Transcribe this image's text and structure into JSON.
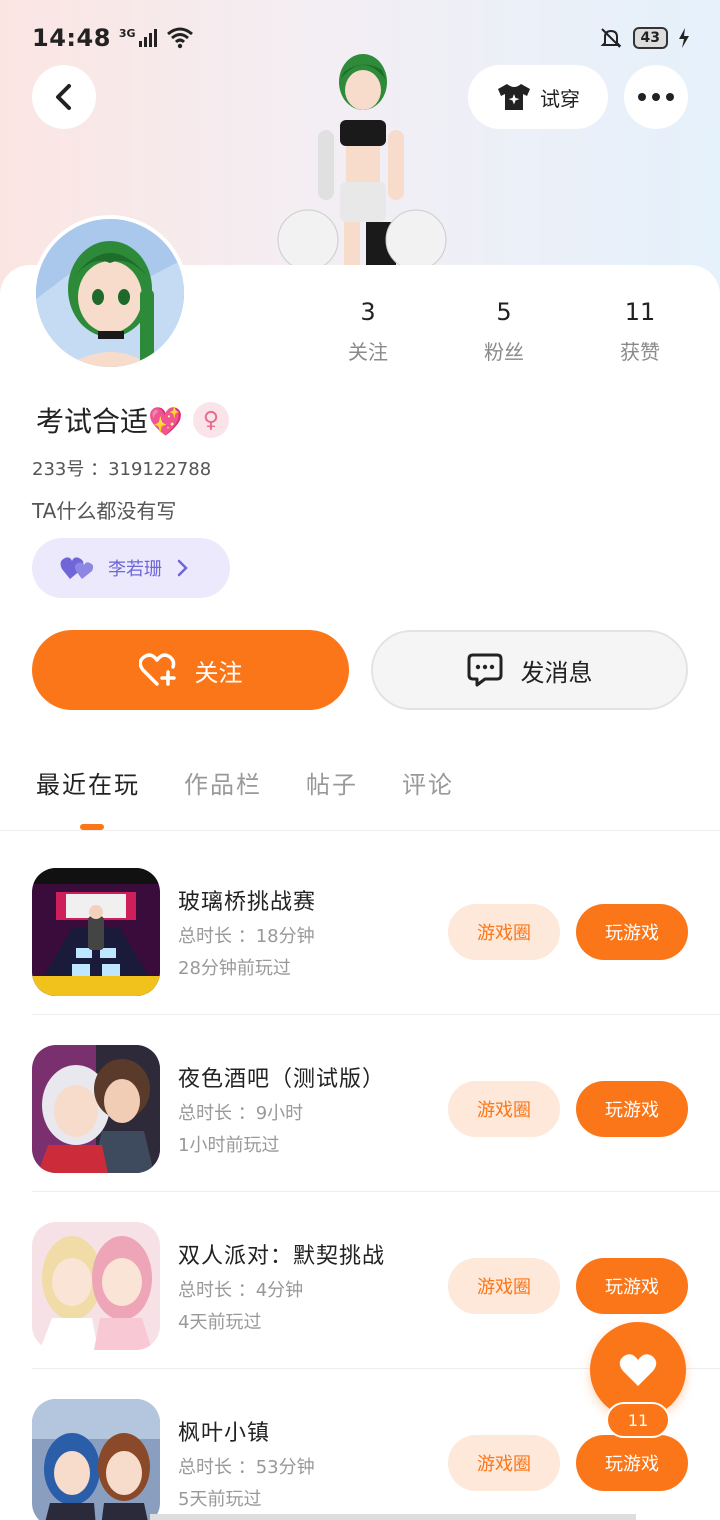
{
  "status_bar": {
    "time": "14:48",
    "network": "3G",
    "battery": "43"
  },
  "header": {
    "tryon_label": "试穿"
  },
  "profile": {
    "username": "考试合适💖",
    "uid": "233号 ：319122788",
    "bio": "TA什么都没有写",
    "cp_name": "李若珊",
    "stats": [
      {
        "value": "3",
        "label": "关注"
      },
      {
        "value": "5",
        "label": "粉丝"
      },
      {
        "value": "11",
        "label": "获赞"
      }
    ]
  },
  "actions": {
    "follow_label": "关注",
    "message_label": "发消息"
  },
  "tabs": [
    {
      "label": "最近在玩"
    },
    {
      "label": "作品栏"
    },
    {
      "label": "帖子"
    },
    {
      "label": "评论"
    }
  ],
  "games": [
    {
      "title": "玻璃桥挑战赛",
      "duration": "总时长 ：18分钟",
      "last_played": "28分钟前玩过",
      "thumb_text": "玻璃桥挑战赛",
      "circle_label": "游戏圈",
      "play_label": "玩游戏"
    },
    {
      "title": "夜色酒吧（测试版）",
      "duration": "总时长 ：9小时",
      "last_played": "1小时前玩过",
      "circle_label": "游戏圈",
      "play_label": "玩游戏"
    },
    {
      "title": "双人派对：默契挑战",
      "duration": "总时长 ：4分钟",
      "last_played": "4天前玩过",
      "circle_label": "游戏圈",
      "play_label": "玩游戏"
    },
    {
      "title": "枫叶小镇",
      "duration": "总时长 ：53分钟",
      "last_played": "5天前玩过",
      "circle_label": "游戏圈",
      "play_label": "玩游戏"
    }
  ],
  "fab": {
    "count": "11"
  },
  "colors": {
    "accent": "#fb7618",
    "accent_light": "#fde8d9",
    "cp_bg": "#ebe9fb",
    "cp_text": "#6f66d8"
  }
}
